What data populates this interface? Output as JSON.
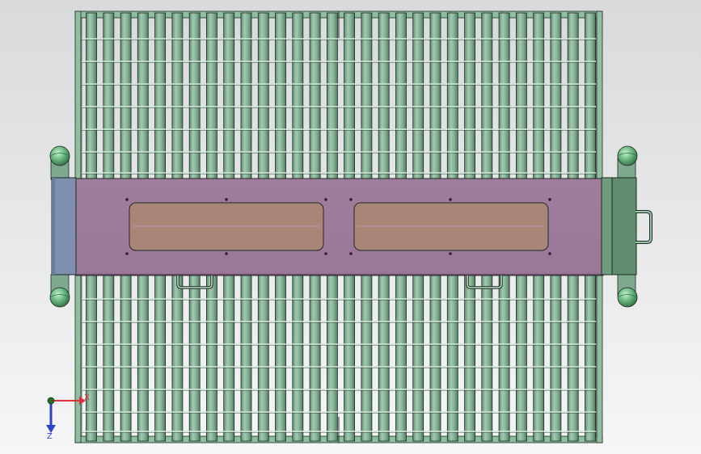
{
  "viewport": {
    "background_top": "#d9dadb",
    "background_bottom": "#f6f6f7"
  },
  "colors": {
    "roller_green": "#7ea98f",
    "roller_green_light": "#9cc4aa",
    "roller_green_dark": "#4f7d62",
    "frame_green": "#8fbf9f",
    "outline": "#1e2a24",
    "purple_plate": "#9a7797",
    "purple_plate_dark": "#7c5d79",
    "window_tan": "#a98577",
    "window_line": "#b39ab8",
    "left_block_blue": "#7f8fb0",
    "right_block_green": "#5f8d6e",
    "knob_green": "#6fbd86",
    "axis_x": "#e0303a",
    "axis_y": "#2a6a2a",
    "axis_z": "#2a42c8"
  },
  "machine": {
    "rollers_top_count": 30,
    "rollers_bottom_count": 30,
    "windows": 2,
    "handles_bottom": 2,
    "handle_right": 1,
    "corner_knobs": 4
  },
  "triad": {
    "x_label": "X",
    "z_label": "Z",
    "x_icon": "x-axis-arrow-icon",
    "y_icon": "y-axis-dot-icon",
    "z_icon": "z-axis-arrow-icon"
  }
}
